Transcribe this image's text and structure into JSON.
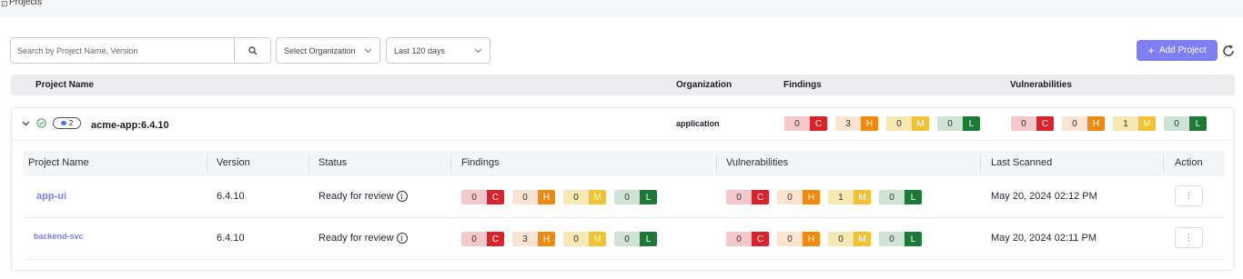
{
  "header": {
    "title": "Projects"
  },
  "toolbar": {
    "search_placeholder": "Search by Project Name, Version",
    "org_select": "Select Organization",
    "days_select": "Last 120 days",
    "add_button": "Add Project"
  },
  "table": {
    "headers": {
      "project_name": "Project Name",
      "organization": "Organization",
      "findings": "Findings",
      "vulnerabilities": "Vulnerabilities"
    }
  },
  "group": {
    "count": "2",
    "name": "acme-app:6.4.10",
    "organization": "application",
    "findings": {
      "C": "0",
      "H": "3",
      "M": "0",
      "L": "0"
    },
    "vulnerabilities": {
      "C": "0",
      "H": "0",
      "M": "1",
      "L": "0"
    }
  },
  "subtable": {
    "headers": {
      "project_name": "Project Name",
      "version": "Version",
      "status": "Status",
      "findings": "Findings",
      "vulnerabilities": "Vulnerabilities",
      "last_scanned": "Last Scanned",
      "action": "Action"
    },
    "rows": [
      {
        "name": "app-ui",
        "version": "6.4.10",
        "status": "Ready for review",
        "findings": {
          "C": "0",
          "H": "0",
          "M": "0",
          "L": "0"
        },
        "vulnerabilities": {
          "C": "0",
          "H": "0",
          "M": "1",
          "L": "0"
        },
        "last_scanned": "May 20, 2024 02:12 PM"
      },
      {
        "name": "backend-svc",
        "version": "6.4.10",
        "status": "Ready for review",
        "findings": {
          "C": "0",
          "H": "3",
          "M": "0",
          "L": "0"
        },
        "vulnerabilities": {
          "C": "0",
          "H": "0",
          "M": "0",
          "L": "0"
        },
        "last_scanned": "May 20, 2024 02:11 PM"
      }
    ]
  },
  "severity_letters": {
    "C": "C",
    "H": "H",
    "M": "M",
    "L": "L"
  },
  "colors": {
    "accent": "#7e7ff2",
    "critical": "#d9222a",
    "critical_bg": "#f5c9cc",
    "high": "#f08a0c",
    "high_bg": "#fbe3d2",
    "medium": "#f2c233",
    "medium_bg": "#f7e7b3",
    "low": "#1d7a36",
    "low_bg": "#cfe3d5"
  }
}
